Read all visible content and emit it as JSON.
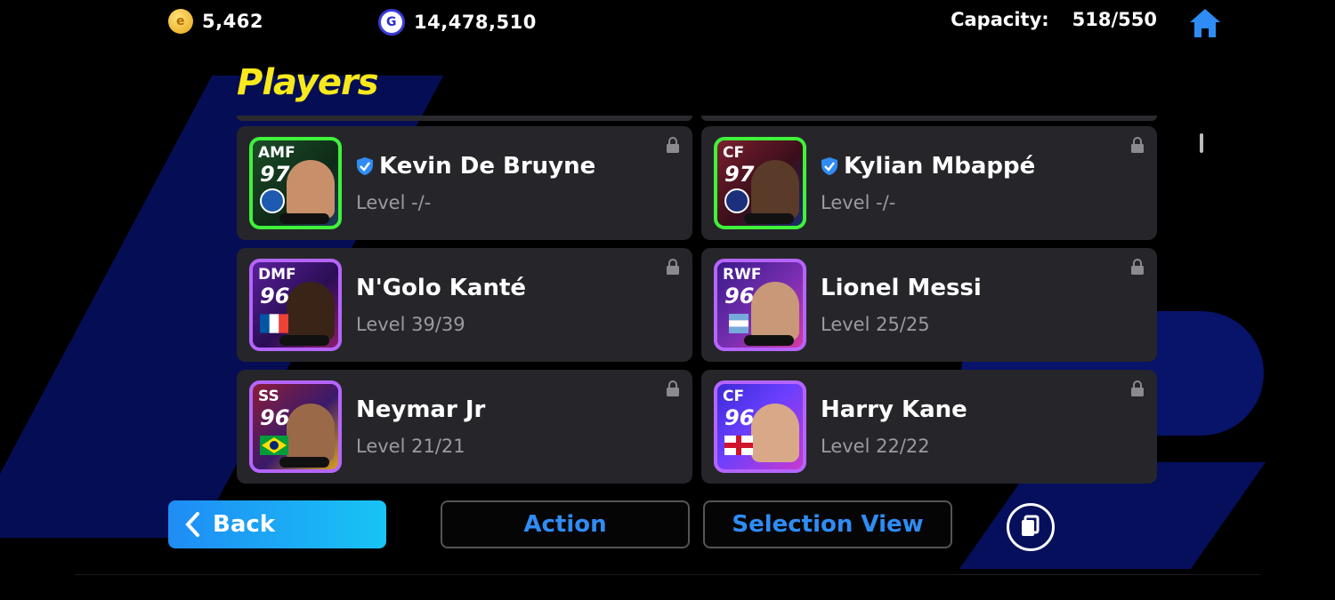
{
  "currency": {
    "coins": "5,462",
    "gp": "14,478,510",
    "coin_icon_text": "e",
    "gp_icon_text": "G"
  },
  "capacity": {
    "label": "Capacity:",
    "value": "518/550"
  },
  "title": "Players",
  "players": [
    {
      "pos": "AMF",
      "ovr": "97",
      "name": "Kevin De Bruyne",
      "level": "Level -/-",
      "verified": true
    },
    {
      "pos": "CF",
      "ovr": "97",
      "name": "Kylian Mbappé",
      "level": "Level -/-",
      "verified": true
    },
    {
      "pos": "DMF",
      "ovr": "96",
      "name": "N'Golo Kanté",
      "level": "Level 39/39",
      "verified": false
    },
    {
      "pos": "RWF",
      "ovr": "96",
      "name": "Lionel Messi",
      "level": "Level 25/25",
      "verified": false
    },
    {
      "pos": "SS",
      "ovr": "96",
      "name": "Neymar Jr",
      "level": "Level 21/21",
      "verified": false
    },
    {
      "pos": "CF",
      "ovr": "96",
      "name": "Harry Kane",
      "level": "Level 22/22",
      "verified": false
    }
  ],
  "buttons": {
    "back": "Back",
    "action": "Action",
    "selection_view": "Selection View"
  },
  "colors": {
    "accent": "#2f8cf5",
    "title": "#f8e81c",
    "card": "#26262a",
    "epic_border": "#3ff23a",
    "featured_border": "#b565ff"
  }
}
